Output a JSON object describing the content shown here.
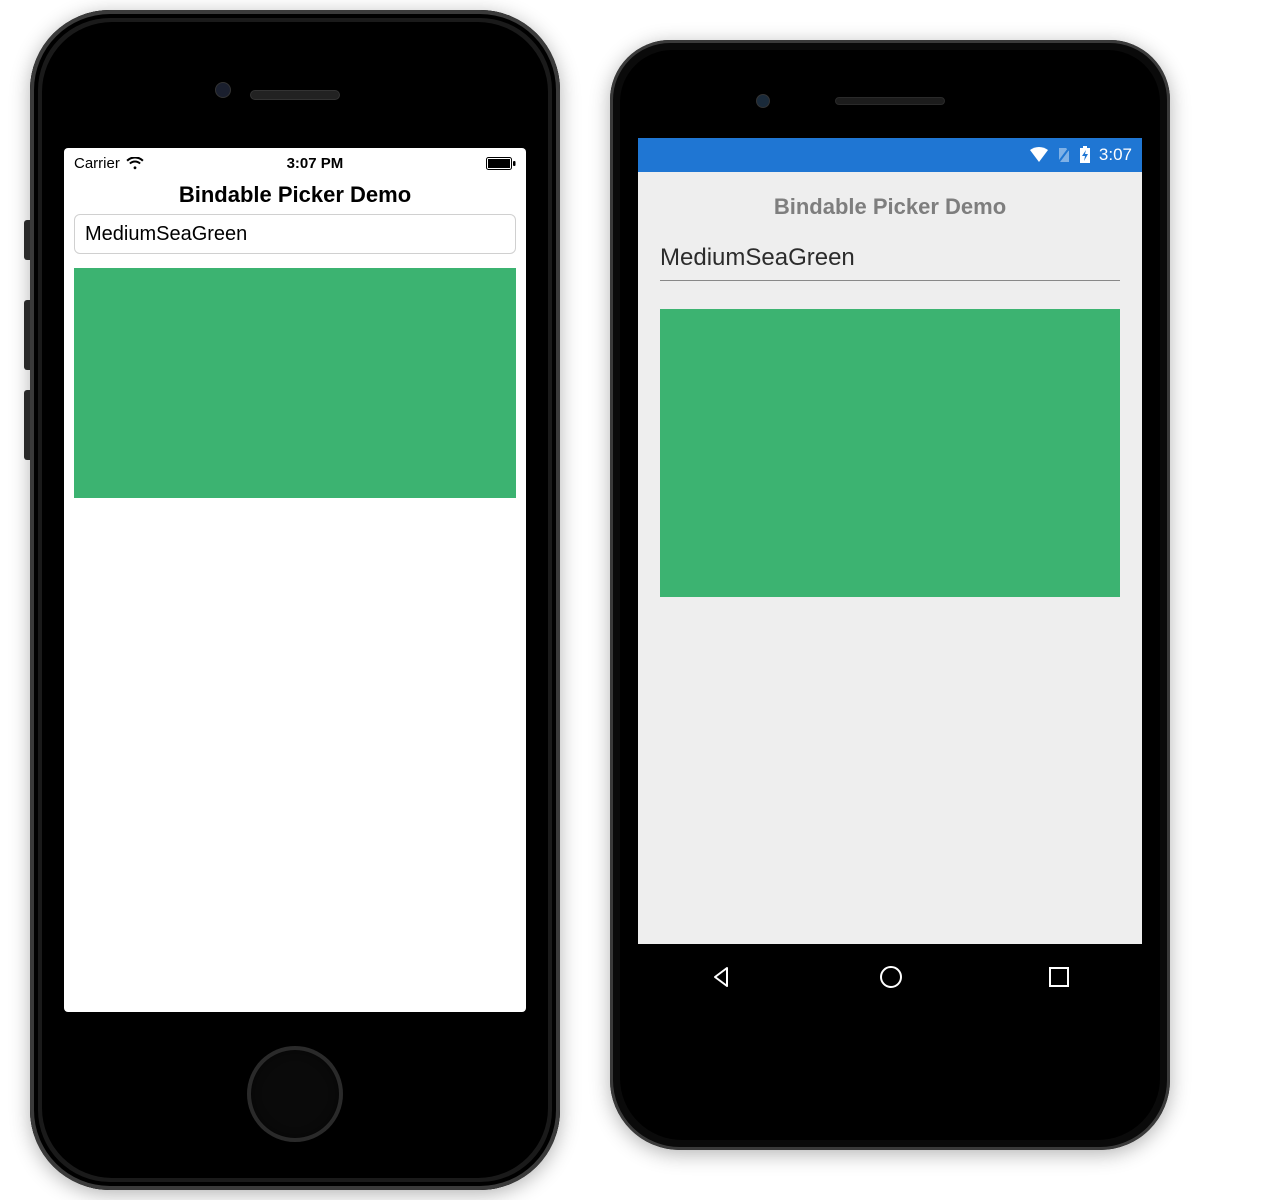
{
  "ios": {
    "status": {
      "carrier": "Carrier",
      "time": "3:07 PM"
    },
    "title": "Bindable Picker Demo",
    "picker_value": "MediumSeaGreen",
    "swatch_color": "#3cb371"
  },
  "android": {
    "status": {
      "time": "3:07"
    },
    "title": "Bindable Picker Demo",
    "picker_value": "MediumSeaGreen",
    "swatch_color": "#3cb371"
  }
}
